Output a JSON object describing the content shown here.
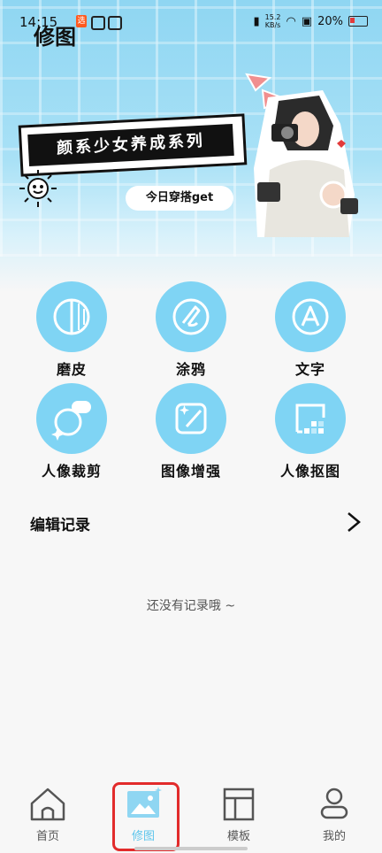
{
  "status_bar": {
    "time": "14:15",
    "badge": "选",
    "speed_value": "15.2",
    "speed_unit": "KB/s",
    "battery": "20%"
  },
  "page": {
    "title": "修图"
  },
  "banner": {
    "headline": "颜系少女养成系列",
    "chip": "今日穿搭get"
  },
  "features": [
    {
      "label": "磨皮",
      "icon": "skin-smooth-icon"
    },
    {
      "label": "涂鸦",
      "icon": "doodle-icon"
    },
    {
      "label": "文字",
      "icon": "text-icon"
    },
    {
      "label": "人像裁剪",
      "icon": "portrait-crop-icon"
    },
    {
      "label": "图像增强",
      "icon": "image-enhance-icon"
    },
    {
      "label": "人像抠图",
      "icon": "portrait-cutout-icon"
    }
  ],
  "records": {
    "title": "编辑记录",
    "empty": "还没有记录哦 ~"
  },
  "nav": {
    "items": [
      {
        "label": "首页",
        "icon": "home-icon"
      },
      {
        "label": "修图",
        "icon": "image-edit-icon",
        "active": true
      },
      {
        "label": "模板",
        "icon": "template-icon"
      },
      {
        "label": "我的",
        "icon": "profile-icon"
      }
    ]
  },
  "colors": {
    "accent": "#7fd4f4",
    "highlight": "#e22b2b"
  }
}
